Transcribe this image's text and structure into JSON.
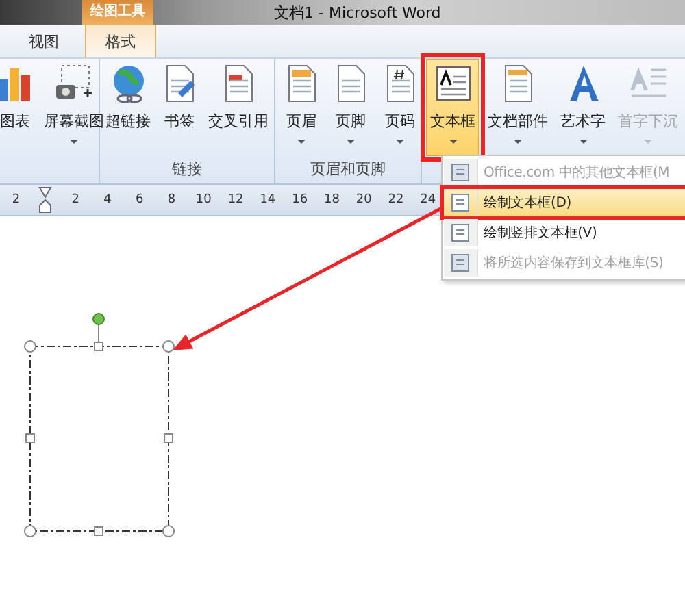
{
  "title_bar": {
    "contextual_group": "绘图工具",
    "title": "文档1 - Microsoft Word"
  },
  "tabs": [
    {
      "label": "视图",
      "selected": false
    },
    {
      "label": "格式",
      "selected": true
    }
  ],
  "ribbon_groups": [
    {
      "buttons": [
        {
          "label": "图表",
          "dropdown": false,
          "selected": false,
          "disabled": false,
          "annotated": false
        },
        {
          "label": "屏幕截图",
          "dropdown": true,
          "selected": false,
          "disabled": false,
          "annotated": false
        }
      ]
    },
    {
      "label": "链接",
      "buttons": [
        {
          "label": "超链接",
          "dropdown": false,
          "selected": false,
          "disabled": false,
          "annotated": false
        },
        {
          "label": "书签",
          "dropdown": false,
          "selected": false,
          "disabled": false,
          "annotated": false
        },
        {
          "label": "交叉引用",
          "dropdown": false,
          "selected": false,
          "disabled": false,
          "annotated": false
        }
      ]
    },
    {
      "label": "页眉和页脚",
      "buttons": [
        {
          "label": "页眉",
          "dropdown": true,
          "selected": false,
          "disabled": false,
          "annotated": false
        },
        {
          "label": "页脚",
          "dropdown": true,
          "selected": false,
          "disabled": false,
          "annotated": false
        },
        {
          "label": "页码",
          "dropdown": true,
          "selected": false,
          "disabled": false,
          "annotated": false
        }
      ]
    },
    {
      "buttons": [
        {
          "label": "文本框",
          "dropdown": true,
          "selected": true,
          "disabled": false,
          "annotated": true
        },
        {
          "label": "文档部件",
          "dropdown": true,
          "selected": false,
          "disabled": false,
          "annotated": false
        },
        {
          "label": "艺术字",
          "dropdown": true,
          "selected": false,
          "disabled": false,
          "annotated": false
        },
        {
          "label": "首字下沉",
          "dropdown": true,
          "selected": false,
          "disabled": true,
          "annotated": false
        }
      ]
    }
  ],
  "ruler": {
    "numbers": [
      "2",
      "2",
      "4",
      "6",
      "8",
      "10",
      "12",
      "14",
      "16",
      "18",
      "20",
      "22",
      "24"
    ]
  },
  "dropdown_menu": {
    "items": [
      {
        "label": "Office.com 中的其他文本框(M",
        "selected": false,
        "disabled": true,
        "annotated": false
      },
      {
        "label": "绘制文本框(D)",
        "selected": true,
        "disabled": false,
        "annotated": true
      },
      {
        "label": "绘制竖排文本框(V)",
        "selected": false,
        "disabled": false,
        "annotated": false
      },
      {
        "label": "将所选内容保存到文本框库(S)",
        "selected": false,
        "disabled": true,
        "annotated": false
      }
    ]
  }
}
